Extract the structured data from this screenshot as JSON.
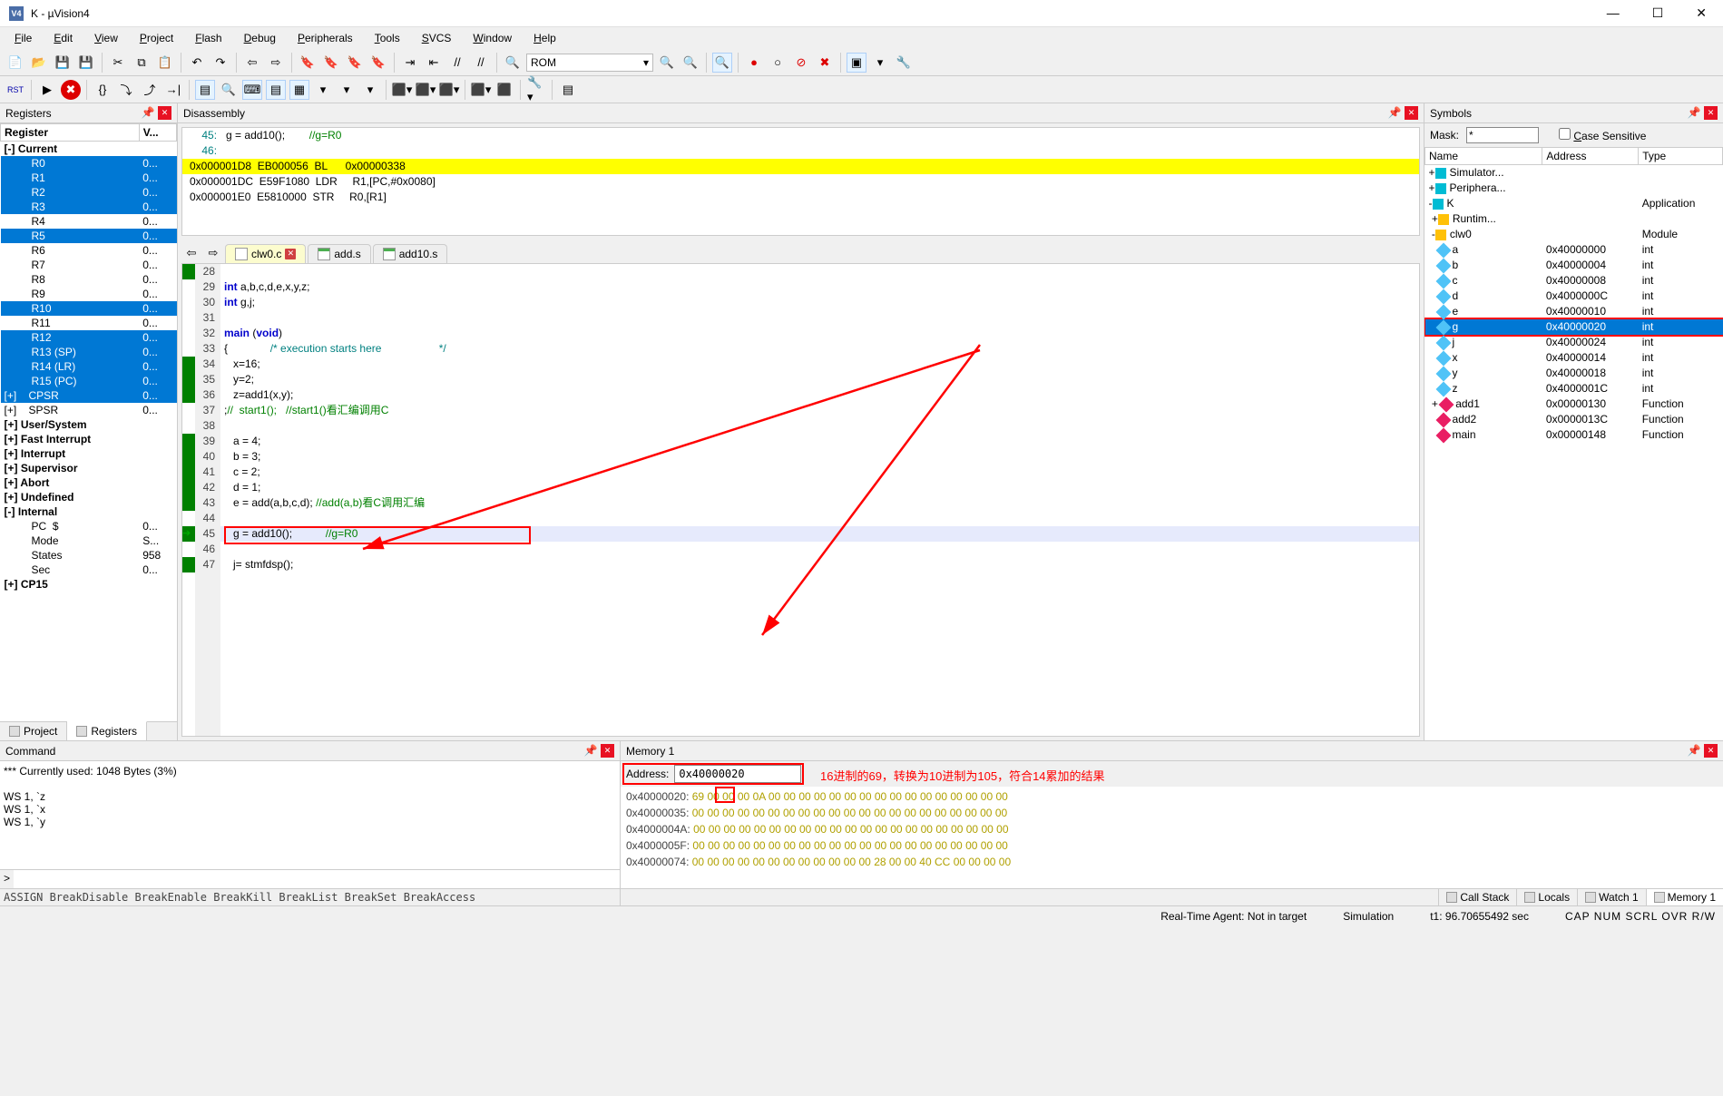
{
  "window": {
    "title": "K  - µVision4"
  },
  "menu": [
    "File",
    "Edit",
    "View",
    "Project",
    "Flash",
    "Debug",
    "Peripherals",
    "Tools",
    "SVCS",
    "Window",
    "Help"
  ],
  "toolbar1_dropdown": "ROM",
  "panes": {
    "registers": "Registers",
    "disassembly": "Disassembly",
    "symbols": "Symbols",
    "command": "Command",
    "memory": "Memory 1"
  },
  "reg_header": [
    "Register",
    "V..."
  ],
  "registers": [
    {
      "t": "cat",
      "n": "Current",
      "v": "",
      "sel": false,
      "exp": "-"
    },
    {
      "t": "reg",
      "n": "R0",
      "v": "0...",
      "sel": true,
      "ind": 2
    },
    {
      "t": "reg",
      "n": "R1",
      "v": "0...",
      "sel": true,
      "ind": 2
    },
    {
      "t": "reg",
      "n": "R2",
      "v": "0...",
      "sel": true,
      "ind": 2
    },
    {
      "t": "reg",
      "n": "R3",
      "v": "0...",
      "sel": true,
      "ind": 2
    },
    {
      "t": "reg",
      "n": "R4",
      "v": "0...",
      "sel": false,
      "ind": 2
    },
    {
      "t": "reg",
      "n": "R5",
      "v": "0...",
      "sel": true,
      "ind": 2
    },
    {
      "t": "reg",
      "n": "R6",
      "v": "0...",
      "sel": false,
      "ind": 2
    },
    {
      "t": "reg",
      "n": "R7",
      "v": "0...",
      "sel": false,
      "ind": 2
    },
    {
      "t": "reg",
      "n": "R8",
      "v": "0...",
      "sel": false,
      "ind": 2
    },
    {
      "t": "reg",
      "n": "R9",
      "v": "0...",
      "sel": false,
      "ind": 2
    },
    {
      "t": "reg",
      "n": "R10",
      "v": "0...",
      "sel": true,
      "ind": 2
    },
    {
      "t": "reg",
      "n": "R11",
      "v": "0...",
      "sel": false,
      "ind": 2
    },
    {
      "t": "reg",
      "n": "R12",
      "v": "0...",
      "sel": true,
      "ind": 2
    },
    {
      "t": "reg",
      "n": "R13 (SP)",
      "v": "0...",
      "sel": true,
      "ind": 2
    },
    {
      "t": "reg",
      "n": "R14 (LR)",
      "v": "0...",
      "sel": true,
      "ind": 2
    },
    {
      "t": "reg",
      "n": "R15 (PC)",
      "v": "0...",
      "sel": true,
      "ind": 2
    },
    {
      "t": "reg",
      "n": "CPSR",
      "v": "0...",
      "sel": true,
      "ind": 1,
      "exp": "+"
    },
    {
      "t": "reg",
      "n": "SPSR",
      "v": "0...",
      "sel": false,
      "ind": 1,
      "exp": "+"
    },
    {
      "t": "cat",
      "n": "User/System",
      "v": "",
      "sel": false,
      "exp": "+"
    },
    {
      "t": "cat",
      "n": "Fast Interrupt",
      "v": "",
      "sel": false,
      "exp": "+"
    },
    {
      "t": "cat",
      "n": "Interrupt",
      "v": "",
      "sel": false,
      "exp": "+"
    },
    {
      "t": "cat",
      "n": "Supervisor",
      "v": "",
      "sel": false,
      "exp": "+",
      "bold": true
    },
    {
      "t": "cat",
      "n": "Abort",
      "v": "",
      "sel": false,
      "exp": "+"
    },
    {
      "t": "cat",
      "n": "Undefined",
      "v": "",
      "sel": false,
      "exp": "+"
    },
    {
      "t": "cat",
      "n": "Internal",
      "v": "",
      "sel": false,
      "exp": "-"
    },
    {
      "t": "reg",
      "n": "PC  $",
      "v": "0...",
      "sel": false,
      "ind": 2
    },
    {
      "t": "reg",
      "n": "Mode",
      "v": "S...",
      "sel": false,
      "ind": 2
    },
    {
      "t": "reg",
      "n": "States",
      "v": "958",
      "sel": false,
      "ind": 2
    },
    {
      "t": "reg",
      "n": "Sec",
      "v": "0...",
      "sel": false,
      "ind": 2
    },
    {
      "t": "cat",
      "n": "CP15",
      "v": "",
      "sel": false,
      "exp": "+"
    }
  ],
  "left_tabs": [
    {
      "label": "Project",
      "active": false
    },
    {
      "label": "Registers",
      "active": true
    }
  ],
  "disasm": [
    {
      "type": "src",
      "num": "45:",
      "code": "g = add10();",
      "cmt": "//g=R0"
    },
    {
      "type": "src",
      "num": "46:",
      "code": "",
      "cmt": ""
    },
    {
      "type": "asm",
      "addr": "0x000001D8",
      "hex": "EB000056",
      "op": "BL",
      "args": "0x00000338",
      "cur": true
    },
    {
      "type": "asm",
      "addr": "0x000001DC",
      "hex": "E59F1080",
      "op": "LDR",
      "args": "R1,[PC,#0x0080]"
    },
    {
      "type": "asm",
      "addr": "0x000001E0",
      "hex": "E5810000",
      "op": "STR",
      "args": "R0,[R1]"
    }
  ],
  "editor_tabs": [
    {
      "name": "clw0.c",
      "active": true,
      "close": true,
      "type": "c"
    },
    {
      "name": "add.s",
      "active": false,
      "close": false,
      "type": "s"
    },
    {
      "name": "add10.s",
      "active": false,
      "close": false,
      "type": "s"
    }
  ],
  "code": [
    {
      "n": 28,
      "t": "",
      "b": true
    },
    {
      "n": 29,
      "t": "int a,b,c,d,e,x,y,z;"
    },
    {
      "n": 30,
      "t": "int g,j;"
    },
    {
      "n": 31,
      "t": ""
    },
    {
      "n": 32,
      "t": "main (void)"
    },
    {
      "n": 33,
      "t": "{",
      "fold": true,
      "cmt": "/* execution starts here                   */",
      "cmtcol": "#008080"
    },
    {
      "n": 34,
      "t": "   x=16;",
      "b": true
    },
    {
      "n": 35,
      "t": "   y=2;",
      "b": true
    },
    {
      "n": 36,
      "t": "   z=add1(x,y);",
      "b": true
    },
    {
      "n": 37,
      "t": ";//  start1();   //start1()看汇编调用C",
      "cmt2": true
    },
    {
      "n": 38,
      "t": ""
    },
    {
      "n": 39,
      "t": "   a = 4;",
      "b": true
    },
    {
      "n": 40,
      "t": "   b = 3;",
      "b": true
    },
    {
      "n": 41,
      "t": "   c = 2;",
      "b": true
    },
    {
      "n": 42,
      "t": "   d = 1;",
      "b": true
    },
    {
      "n": 43,
      "t": "   e = add(a,b,c,d); //add(a,b)看C调用汇编",
      "b": true
    },
    {
      "n": 44,
      "t": ""
    },
    {
      "n": 45,
      "t": "   g = add10();",
      "b": true,
      "pc": true,
      "cmtpost": "//g=R0"
    },
    {
      "n": 46,
      "t": ""
    },
    {
      "n": 47,
      "t": "   j= stmfdsp();",
      "b": true
    }
  ],
  "symbols": {
    "mask_label": "Mask:",
    "mask_value": "*",
    "case_label": "Case Sensitive",
    "headers": [
      "Name",
      "Address",
      "Type"
    ],
    "rows": [
      {
        "pre": "+",
        "icon": "app",
        "n": "Simulator...",
        "a": "",
        "t": ""
      },
      {
        "pre": "+",
        "icon": "per",
        "n": "Periphera...",
        "a": "",
        "t": ""
      },
      {
        "pre": "-",
        "icon": "app",
        "n": "K",
        "a": "",
        "t": "Application"
      },
      {
        "pre": " +",
        "icon": "folder",
        "n": "Runtim...",
        "a": "",
        "t": ""
      },
      {
        "pre": " -",
        "icon": "folder",
        "n": "clw0",
        "a": "",
        "t": "Module"
      },
      {
        "pre": "   ",
        "icon": "var",
        "n": "a",
        "a": "0x40000000",
        "t": "int"
      },
      {
        "pre": "   ",
        "icon": "var",
        "n": "b",
        "a": "0x40000004",
        "t": "int"
      },
      {
        "pre": "   ",
        "icon": "var",
        "n": "c",
        "a": "0x40000008",
        "t": "int"
      },
      {
        "pre": "   ",
        "icon": "var",
        "n": "d",
        "a": "0x4000000C",
        "t": "int"
      },
      {
        "pre": "   ",
        "icon": "var",
        "n": "e",
        "a": "0x40000010",
        "t": "int"
      },
      {
        "pre": "   ",
        "icon": "var",
        "n": "g",
        "a": "0x40000020",
        "t": "int",
        "sel": true,
        "box": true
      },
      {
        "pre": "   ",
        "icon": "var",
        "n": "j",
        "a": "0x40000024",
        "t": "int"
      },
      {
        "pre": "   ",
        "icon": "var",
        "n": "x",
        "a": "0x40000014",
        "t": "int"
      },
      {
        "pre": "   ",
        "icon": "var",
        "n": "y",
        "a": "0x40000018",
        "t": "int"
      },
      {
        "pre": "   ",
        "icon": "var",
        "n": "z",
        "a": "0x4000001C",
        "t": "int"
      },
      {
        "pre": " + ",
        "icon": "func",
        "n": "add1",
        "a": "0x00000130",
        "t": "Function"
      },
      {
        "pre": "   ",
        "icon": "func",
        "n": "add2",
        "a": "0x0000013C",
        "t": "Function"
      },
      {
        "pre": "   ",
        "icon": "func",
        "n": "main",
        "a": "0x00000148",
        "t": "Function"
      }
    ]
  },
  "command": {
    "out": "*** Currently used: 1048 Bytes (3%)\n\nWS 1, `z\nWS 1, `x\nWS 1, `y",
    "prompt": ">",
    "hint": "ASSIGN BreakDisable BreakEnable BreakKill BreakList BreakSet BreakAccess"
  },
  "memory": {
    "addr_label": "Address:",
    "addr_value": "0x40000020",
    "note": "16进制的69，转换为10进制为105，符合14累加的结果",
    "lines": [
      {
        "a": "0x40000020:",
        "b": [
          "69",
          "00",
          "00",
          "00",
          "0A",
          "00",
          "00",
          "00",
          "00",
          "00",
          "00",
          "00",
          "00",
          "00",
          "00",
          "00",
          "00",
          "00",
          "00",
          "00",
          "00"
        ],
        "hi": 0
      },
      {
        "a": "0x40000035:",
        "b": [
          "00",
          "00",
          "00",
          "00",
          "00",
          "00",
          "00",
          "00",
          "00",
          "00",
          "00",
          "00",
          "00",
          "00",
          "00",
          "00",
          "00",
          "00",
          "00",
          "00",
          "00"
        ]
      },
      {
        "a": "0x4000004A:",
        "b": [
          "00",
          "00",
          "00",
          "00",
          "00",
          "00",
          "00",
          "00",
          "00",
          "00",
          "00",
          "00",
          "00",
          "00",
          "00",
          "00",
          "00",
          "00",
          "00",
          "00",
          "00"
        ]
      },
      {
        "a": "0x4000005F:",
        "b": [
          "00",
          "00",
          "00",
          "00",
          "00",
          "00",
          "00",
          "00",
          "00",
          "00",
          "00",
          "00",
          "00",
          "00",
          "00",
          "00",
          "00",
          "00",
          "00",
          "00",
          "00"
        ]
      },
      {
        "a": "0x40000074:",
        "b": [
          "00",
          "00",
          "00",
          "00",
          "00",
          "00",
          "00",
          "00",
          "00",
          "00",
          "00",
          "00",
          "28",
          "00",
          "00",
          "40",
          "CC",
          "00",
          "00",
          "00",
          "00"
        ]
      }
    ],
    "tabs": [
      {
        "label": "Call Stack",
        "active": false
      },
      {
        "label": "Locals",
        "active": false
      },
      {
        "label": "Watch 1",
        "active": false
      },
      {
        "label": "Memory 1",
        "active": true
      }
    ]
  },
  "status": {
    "agent": "Real-Time Agent: Not in target",
    "sim": "Simulation",
    "t1": "t1: 96.70655492 sec",
    "caps": "CAP  NUM  SCRL  OVR  R/W"
  }
}
